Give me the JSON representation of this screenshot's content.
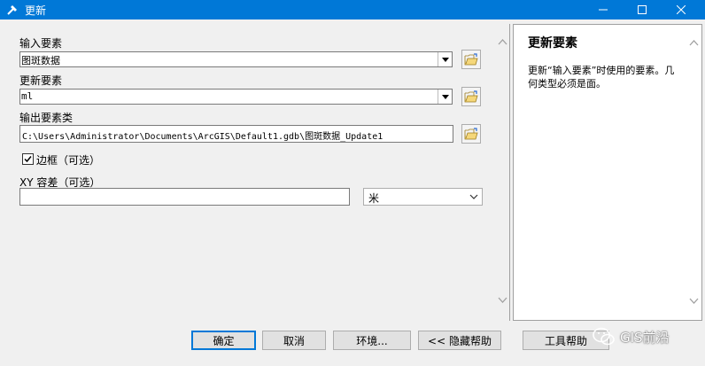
{
  "window": {
    "title": "更新"
  },
  "form": {
    "input_features_label": "输入要素",
    "input_features_value": "图斑数据",
    "update_features_label": "更新要素",
    "update_features_value": "ml",
    "output_class_label": "输出要素类",
    "output_class_value": "C:\\Users\\Administrator\\Documents\\ArcGIS\\Default1.gdb\\图斑数据_Update1",
    "border_label": "边框（可选）",
    "border_checked": true,
    "xy_tolerance_label": "XY 容差（可选）",
    "xy_tolerance_value": "",
    "unit_value": "米"
  },
  "help": {
    "title": "更新要素",
    "body": "更新“输入要素”时使用的要素。几何类型必须是面。"
  },
  "buttons": {
    "ok": "确定",
    "cancel": "取消",
    "environments": "环境...",
    "hide_help": "<< 隐藏帮助",
    "tool_help": "工具帮助"
  },
  "watermark": {
    "text": "GIS前沿"
  }
}
